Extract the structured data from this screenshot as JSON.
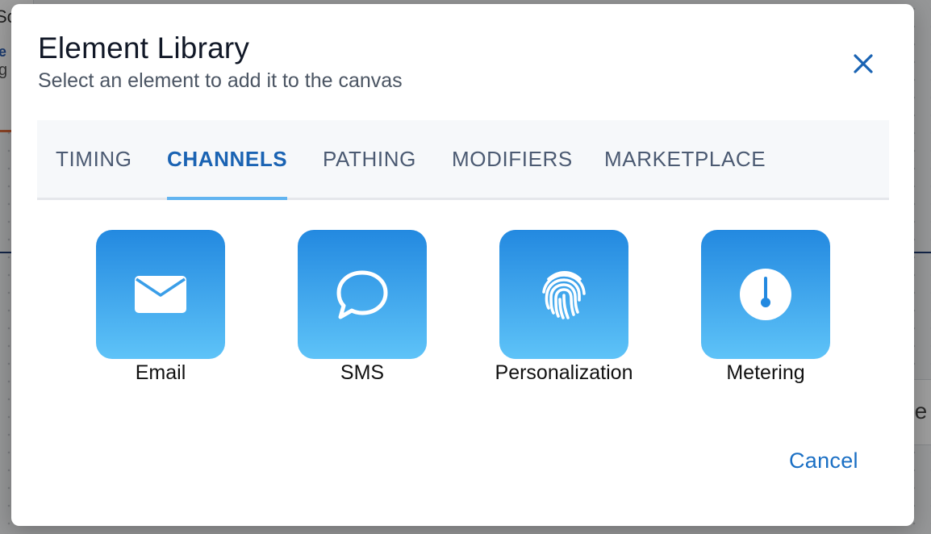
{
  "dialog": {
    "title": "Element Library",
    "subtitle": "Select an element to add it to the canvas",
    "close_icon": "close-icon",
    "cancel_label": "Cancel"
  },
  "tabs": [
    {
      "label": "TIMING",
      "active": false
    },
    {
      "label": "CHANNELS",
      "active": true
    },
    {
      "label": "PATHING",
      "active": false
    },
    {
      "label": "MODIFIERS",
      "active": false
    },
    {
      "label": "MARKETPLACE",
      "active": false
    }
  ],
  "elements": [
    {
      "label": "Email",
      "icon": "envelope-icon"
    },
    {
      "label": "SMS",
      "icon": "speech-bubble-icon"
    },
    {
      "label": "Personalization",
      "icon": "fingerprint-icon"
    },
    {
      "label": "Metering",
      "icon": "gauge-icon"
    }
  ],
  "colors": {
    "accent": "#1a63b3",
    "tab_underline": "#62b4f0",
    "tile_gradient_top": "#2389e0",
    "tile_gradient_bottom": "#5ec3f8",
    "cancel": "#1a6fc4"
  }
}
